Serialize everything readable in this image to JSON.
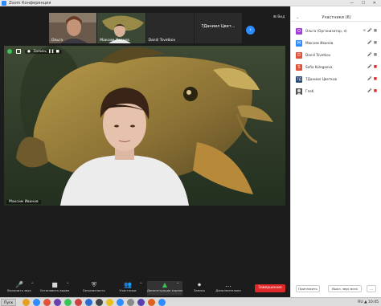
{
  "window": {
    "title": "Zoom Конференция",
    "controls": "— ☐ ✕"
  },
  "view_button": {
    "label": "Вид"
  },
  "video_strip": [
    {
      "name": "Ольга"
    },
    {
      "name": "Максим Иванов"
    },
    {
      "name": "Daniil Tsvetkov"
    },
    {
      "name": "7Даниил Цвет...",
      "display": "7Даниил Цвет..."
    }
  ],
  "stage": {
    "speaker_name": "Максим Иванов",
    "record_label": "Запись"
  },
  "toolbar": {
    "items": [
      {
        "icon": "🎤",
        "label": "Включить звук"
      },
      {
        "icon": "■",
        "label": "Остановить видео"
      },
      {
        "icon": "⛨",
        "label": "Безопасность"
      },
      {
        "icon": "👥",
        "label": "Участники"
      },
      {
        "icon": "▲",
        "label": "Демонстрация экрана"
      },
      {
        "icon": "⏺",
        "label": "Запись"
      },
      {
        "icon": "…",
        "label": "Дополнительно"
      }
    ],
    "end_label": "Завершение"
  },
  "panel": {
    "title": "Участники (6)",
    "participants": [
      {
        "initial": "О",
        "color": "#a13fd9",
        "name": "Ольга (Организатор, я)",
        "extra": "⊕",
        "mic_muted": false,
        "cam_off": false
      },
      {
        "initial": "М",
        "color": "#2d8cff",
        "name": "Максим Иванов",
        "extra": "",
        "mic_muted": false,
        "cam_off": false
      },
      {
        "initial": "D",
        "color": "#e0523c",
        "name": "Daniil Tsvetkov",
        "extra": "",
        "mic_muted": false,
        "cam_off": false
      },
      {
        "initial": "S",
        "color": "#e0523c",
        "name": "Sofia Kolegaeva",
        "extra": "",
        "mic_muted": true,
        "cam_off": true
      },
      {
        "initial": "7Д",
        "color": "#2d4a7a",
        "name": "7Даниил Цветков",
        "extra": "",
        "mic_muted": true,
        "cam_off": true
      },
      {
        "initial": "",
        "color": "#444444",
        "name": "Глеб",
        "extra": "",
        "mic_muted": true,
        "cam_off": true
      }
    ],
    "invite_label": "Пригласить",
    "mute_all_label": "Выкл. звук всех",
    "more_label": "..."
  },
  "taskbar": {
    "start_label": "Пуск",
    "tray_text": "RU ▲ 10:45"
  }
}
